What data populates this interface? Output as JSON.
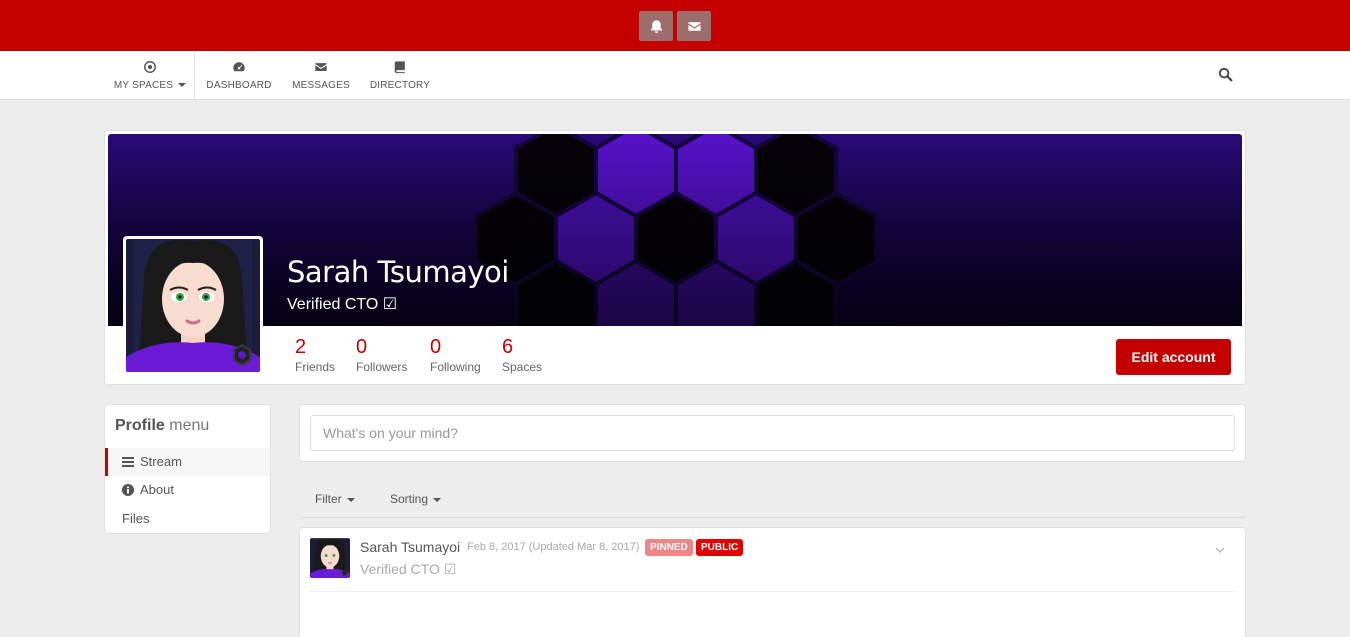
{
  "topbar": {
    "color": "#c40000",
    "buttons": [
      {
        "icon": "bell-icon"
      },
      {
        "icon": "envelope-icon"
      }
    ]
  },
  "nav": {
    "items": [
      {
        "label": "MY SPACES",
        "icon": "target-icon"
      },
      {
        "label": "DASHBOARD",
        "icon": "tachometer-icon"
      },
      {
        "label": "MESSAGES",
        "icon": "envelope-icon"
      },
      {
        "label": "DIRECTORY",
        "icon": "book-icon"
      }
    ],
    "search_icon": "search-icon"
  },
  "profile": {
    "name": "Sarah Tsumayoi",
    "title": "Verified CTO ☑",
    "stats": [
      {
        "value": "2",
        "label": "Friends"
      },
      {
        "value": "0",
        "label": "Followers"
      },
      {
        "value": "0",
        "label": "Following"
      },
      {
        "value": "6",
        "label": "Spaces"
      }
    ],
    "edit_label": "Edit account"
  },
  "profile_menu": {
    "title_bold": "Profile",
    "title_rest": "menu",
    "items": [
      {
        "label": "Stream",
        "icon": "bars-icon",
        "active": true
      },
      {
        "label": "About",
        "icon": "info-circle-icon",
        "active": false
      },
      {
        "label": "Files",
        "icon": "",
        "active": false
      }
    ]
  },
  "composer": {
    "placeholder": "What's on your mind?"
  },
  "stream_controls": {
    "filter_label": "Filter",
    "sorting_label": "Sorting"
  },
  "entry": {
    "author": "Sarah Tsumayoi",
    "date": "Feb 8, 2017 (Updated Mar 8, 2017)",
    "badges": [
      {
        "label": "PINNED",
        "color": "#f08585"
      },
      {
        "label": "PUBLIC",
        "color": "#e00000"
      }
    ],
    "subtitle": "Verified CTO ☑"
  }
}
